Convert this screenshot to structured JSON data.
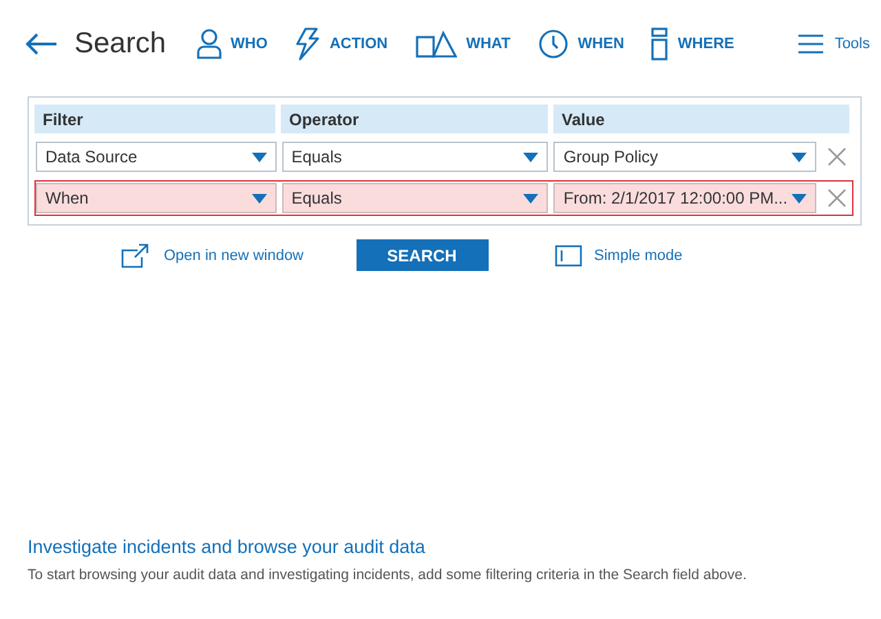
{
  "header": {
    "title": "Search",
    "nav": [
      {
        "kind": "who",
        "label": "WHO"
      },
      {
        "kind": "action",
        "label": "ACTION"
      },
      {
        "kind": "what",
        "label": "WHAT"
      },
      {
        "kind": "when",
        "label": "WHEN"
      },
      {
        "kind": "where",
        "label": "WHERE"
      }
    ],
    "tools": "Tools"
  },
  "filter_table": {
    "columns": [
      "Filter",
      "Operator",
      "Value"
    ],
    "rows": [
      {
        "filter": "Data Source",
        "operator": "Equals",
        "value": "Group Policy",
        "invalid": false
      },
      {
        "filter": "When",
        "operator": "Equals",
        "value": "From: 2/1/2017 12:00:00 PM...",
        "invalid": true
      }
    ]
  },
  "actions": {
    "open_link": "Open in new window",
    "search_button": "SEARCH",
    "simple_mode": "Simple mode"
  },
  "info": {
    "heading": "Investigate incidents and browse your audit data",
    "text": "To start browsing your audit data and investigating incidents, add some filtering criteria in the Search field above."
  }
}
